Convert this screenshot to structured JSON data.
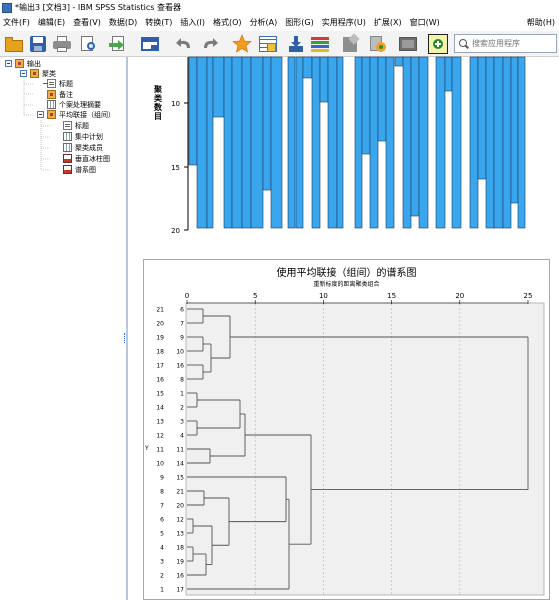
{
  "window": {
    "title": "*输出3 [文档3] - IBM SPSS Statistics 查看器"
  },
  "menu": [
    "文件(F)",
    "编辑(E)",
    "查看(V)",
    "数据(D)",
    "转换(T)",
    "插入(I)",
    "格式(O)",
    "分析(A)",
    "图形(G)",
    "实用程序(U)",
    "扩展(X)",
    "窗口(W)",
    "帮助(H)"
  ],
  "toolbar": {
    "icons": [
      "open-folder-icon",
      "save-icon",
      "print-icon",
      "print-preview-icon",
      "export-icon",
      "recall-dialog-icon",
      "undo-icon",
      "redo-icon",
      "goto-data-icon",
      "goto-variable-icon",
      "insert-output-icon",
      "designate-window-icon",
      "promote-icon",
      "demote-icon",
      "hide-icon",
      "show-icon",
      "create-script-icon"
    ],
    "search_placeholder": "搜索应用程序"
  },
  "outline": {
    "items": [
      {
        "label": "输出",
        "level": 0,
        "icon": "book",
        "expander": true
      },
      {
        "label": "聚类",
        "level": 1,
        "icon": "book",
        "expander": true
      },
      {
        "label": "标题",
        "level": 2,
        "icon": "doc",
        "marker": "redarrow"
      },
      {
        "label": "备注",
        "level": 2,
        "icon": "book"
      },
      {
        "label": "个案处理摘要",
        "level": 2,
        "icon": "table"
      },
      {
        "label": "平均联接（组间）",
        "level": 2,
        "icon": "book",
        "expander": true
      },
      {
        "label": "标题",
        "level": 3,
        "icon": "doc"
      },
      {
        "label": "集中计划",
        "level": 3,
        "icon": "table"
      },
      {
        "label": "聚类成员",
        "level": 3,
        "icon": "table"
      },
      {
        "label": "垂直冰柱图",
        "level": 3,
        "icon": "chart"
      },
      {
        "label": "谱系图",
        "level": 3,
        "icon": "chart"
      }
    ]
  },
  "icicle": {
    "ylabel": "聚类数目",
    "ticks": [
      "10",
      "15",
      "20"
    ],
    "bar_color": "#3aa6ee"
  },
  "dendrogram": {
    "title": "使用平均联接（组间）的谱系图",
    "subtitle": "重新标度的距离聚类组合",
    "y_axis_label": "Y",
    "x_ticks": [
      "0",
      "5",
      "10",
      "15",
      "20",
      "25"
    ],
    "leaves": [
      {
        "label": "21",
        "case": "6"
      },
      {
        "label": "20",
        "case": "7"
      },
      {
        "label": "19",
        "case": "9"
      },
      {
        "label": "18",
        "case": "10"
      },
      {
        "label": "17",
        "case": "16"
      },
      {
        "label": "16",
        "case": "8"
      },
      {
        "label": "15",
        "case": "1"
      },
      {
        "label": "14",
        "case": "2"
      },
      {
        "label": "13",
        "case": "3"
      },
      {
        "label": "12",
        "case": "4"
      },
      {
        "label": "11",
        "case": "11"
      },
      {
        "label": "10",
        "case": "14"
      },
      {
        "label": "9",
        "case": "15"
      },
      {
        "label": "8",
        "case": "21"
      },
      {
        "label": "7",
        "case": "20"
      },
      {
        "label": "6",
        "case": "12"
      },
      {
        "label": "5",
        "case": "13"
      },
      {
        "label": "4",
        "case": "18"
      },
      {
        "label": "3",
        "case": "19"
      },
      {
        "label": "2",
        "case": "16"
      },
      {
        "label": "1",
        "case": "17"
      }
    ]
  }
}
